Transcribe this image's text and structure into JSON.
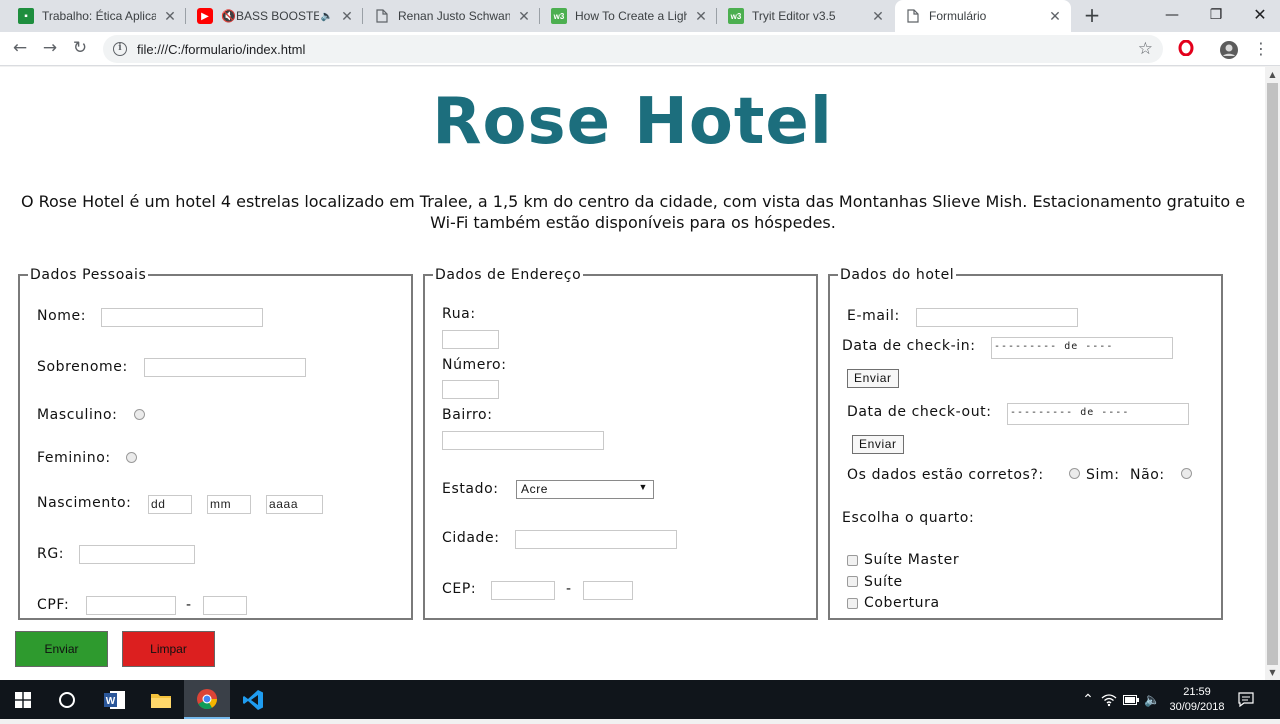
{
  "browser": {
    "tabs": [
      {
        "label": "Trabalho: Ética Aplicada",
        "favicon": "classroom-icon",
        "active": false
      },
      {
        "label": "🔇BASS BOOSTED🔇",
        "favicon": "youtube-icon",
        "active": false
      },
      {
        "label": "Renan Justo Schwanck",
        "favicon": "document-icon",
        "active": false
      },
      {
        "label": "How To Create a Lightb",
        "favicon": "w3schools-icon",
        "active": false
      },
      {
        "label": "Tryit Editor v3.5",
        "favicon": "w3schools-icon",
        "active": false
      },
      {
        "label": "Formulário",
        "favicon": "document-icon",
        "active": true
      }
    ],
    "w3_badge": "w3",
    "url": "file:///C:/formulario/index.html"
  },
  "page": {
    "title": "Rose Hotel",
    "intro": "O Rose Hotel é um hotel 4 estrelas localizado em Tralee, a 1,5 km do centro da cidade, com vista das Montanhas Slieve Mish. Estacionamento gratuito e Wi-Fi também estão disponíveis para os hóspedes.",
    "title_color": "#1c6e7d",
    "pessoais": {
      "legend": "Dados Pessoais",
      "nome": "Nome:",
      "sobrenome": "Sobrenome:",
      "masculino": "Masculino:",
      "feminino": "Feminino:",
      "nascimento": "Nascimento:",
      "dd": "dd",
      "mm": "mm",
      "aaaa": "aaaa",
      "rg": "RG:",
      "cpf": "CPF:",
      "cpf_sep": "-"
    },
    "endereco": {
      "legend": "Dados de Endereço",
      "rua": "Rua:",
      "numero": "Número:",
      "bairro": "Bairro:",
      "estado": "Estado:",
      "estado_value": "Acre",
      "cidade": "Cidade:",
      "cep": "CEP:",
      "cep_sep": "-"
    },
    "hotel": {
      "legend": "Dados do hotel",
      "email": "E-mail:",
      "checkin": "Data de check-in:",
      "checkin_value": "--------- de ----",
      "enviar": "Enviar",
      "checkout": "Data de check-out:",
      "checkout_value": "--------- de ----",
      "corretos": "Os dados estão corretos?:",
      "sim": "Sim:",
      "nao": "Não:",
      "quarto": "Escolha o quarto:",
      "rooms": [
        "Suíte Master",
        "Suíte",
        "Cobertura"
      ]
    },
    "submit": {
      "label": "Enviar",
      "color": "#2e9a2e"
    },
    "reset": {
      "label": "Limpar",
      "color": "#dc1f1f"
    }
  },
  "taskbar": {
    "time": "21:59",
    "date": "30/09/2018",
    "word_letter": "W"
  }
}
